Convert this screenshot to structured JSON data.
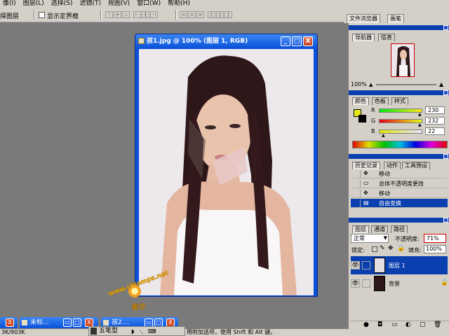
{
  "menubar": {
    "items": [
      "像(I)",
      "图层(L)",
      "选择(S)",
      "滤镜(T)",
      "视图(V)",
      "窗口(W)",
      "帮助(H)"
    ]
  },
  "options": {
    "tool_label": "择图层",
    "show_bounds_label": "显示定界框",
    "palette_tabs": [
      "文件浏览器",
      "画笔"
    ]
  },
  "document": {
    "title": "孩1.jpg @ 100% (图层 1, RGB)",
    "btn_min": "_",
    "btn_max": "□",
    "btn_close": "X"
  },
  "navigator": {
    "tabs": [
      "导航器",
      "信息"
    ],
    "zoom": "100%"
  },
  "color": {
    "tabs": [
      "颜色",
      "色板",
      "样式"
    ],
    "channels": [
      {
        "name": "R",
        "value": "230"
      },
      {
        "name": "G",
        "value": "232"
      },
      {
        "name": "B",
        "value": "22"
      }
    ],
    "foreground": "#e8e816",
    "background": "#000000"
  },
  "history": {
    "tabs": [
      "历史记录",
      "动作",
      "工具预设"
    ],
    "items": [
      "移动",
      "总体不透明度更改",
      "移动",
      "自由变换"
    ],
    "selected_index": 3
  },
  "layers": {
    "tabs": [
      "图层",
      "通道",
      "路径"
    ],
    "blend_mode": "正常",
    "opacity_label": "不透明度:",
    "opacity_value": "71%",
    "lock_label": "锁定:",
    "fill_label": "填充:",
    "fill_value": "100%",
    "rows": [
      {
        "name": "图层 1",
        "selected": true
      },
      {
        "name": "背景",
        "selected": false
      }
    ]
  },
  "minimized": [
    {
      "title": "未标..."
    },
    {
      "title": "孩2...."
    }
  ],
  "ime": {
    "label": "五笔型"
  },
  "status": {
    "left": "3K/903K",
    "hint": "用附加选项，使用 Shift 和 Alt 键。"
  },
  "watermark": {
    "text1": "www.chiamps.net",
    "text2": "能华"
  },
  "colors": {
    "title_blue": "#0a52d8",
    "selection_blue": "#0a3fb0",
    "panel_gray": "#d4d0c8",
    "workspace_gray": "#7a7a7a"
  }
}
